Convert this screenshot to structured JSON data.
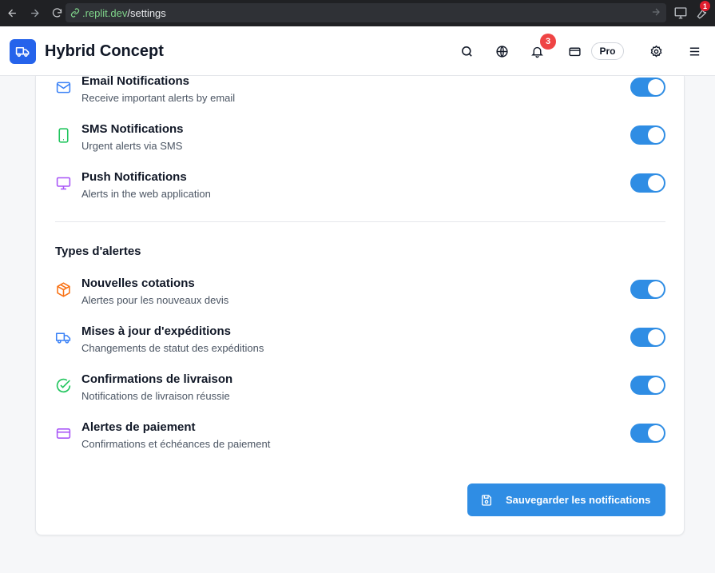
{
  "browser": {
    "url_host": ".replit.dev",
    "url_path": "/settings",
    "extension_badge": "1"
  },
  "header": {
    "brand": "Hybrid Concept",
    "notification_count": "3",
    "plan_badge": "Pro"
  },
  "channels": [
    {
      "icon": "mail-icon",
      "title": "Email Notifications",
      "desc": "Receive important alerts by email",
      "enabled": true,
      "color": "#3b82f6"
    },
    {
      "icon": "smartphone-icon",
      "title": "SMS Notifications",
      "desc": "Urgent alerts via SMS",
      "enabled": true,
      "color": "#22c55e"
    },
    {
      "icon": "monitor-icon",
      "title": "Push Notifications",
      "desc": "Alerts in the web application",
      "enabled": true,
      "color": "#a855f7"
    }
  ],
  "alert_types_title": "Types d'alertes",
  "alert_types": [
    {
      "icon": "package-icon",
      "title": "Nouvelles cotations",
      "desc": "Alertes pour les nouveaux devis",
      "enabled": true,
      "color": "#f97316"
    },
    {
      "icon": "truck-icon",
      "title": "Mises à jour d'expéditions",
      "desc": "Changements de statut des expéditions",
      "enabled": true,
      "color": "#3b82f6"
    },
    {
      "icon": "check-circle-icon",
      "title": "Confirmations de livraison",
      "desc": "Notifications de livraison réussie",
      "enabled": true,
      "color": "#22c55e"
    },
    {
      "icon": "credit-card-icon",
      "title": "Alertes de paiement",
      "desc": "Confirmations et échéances de paiement",
      "enabled": true,
      "color": "#a855f7"
    }
  ],
  "save_button": "Sauvegarder les notifications",
  "colors": {
    "accent": "#2f8de4",
    "brand_blue": "#2563eb",
    "badge_red": "#ef4444"
  }
}
